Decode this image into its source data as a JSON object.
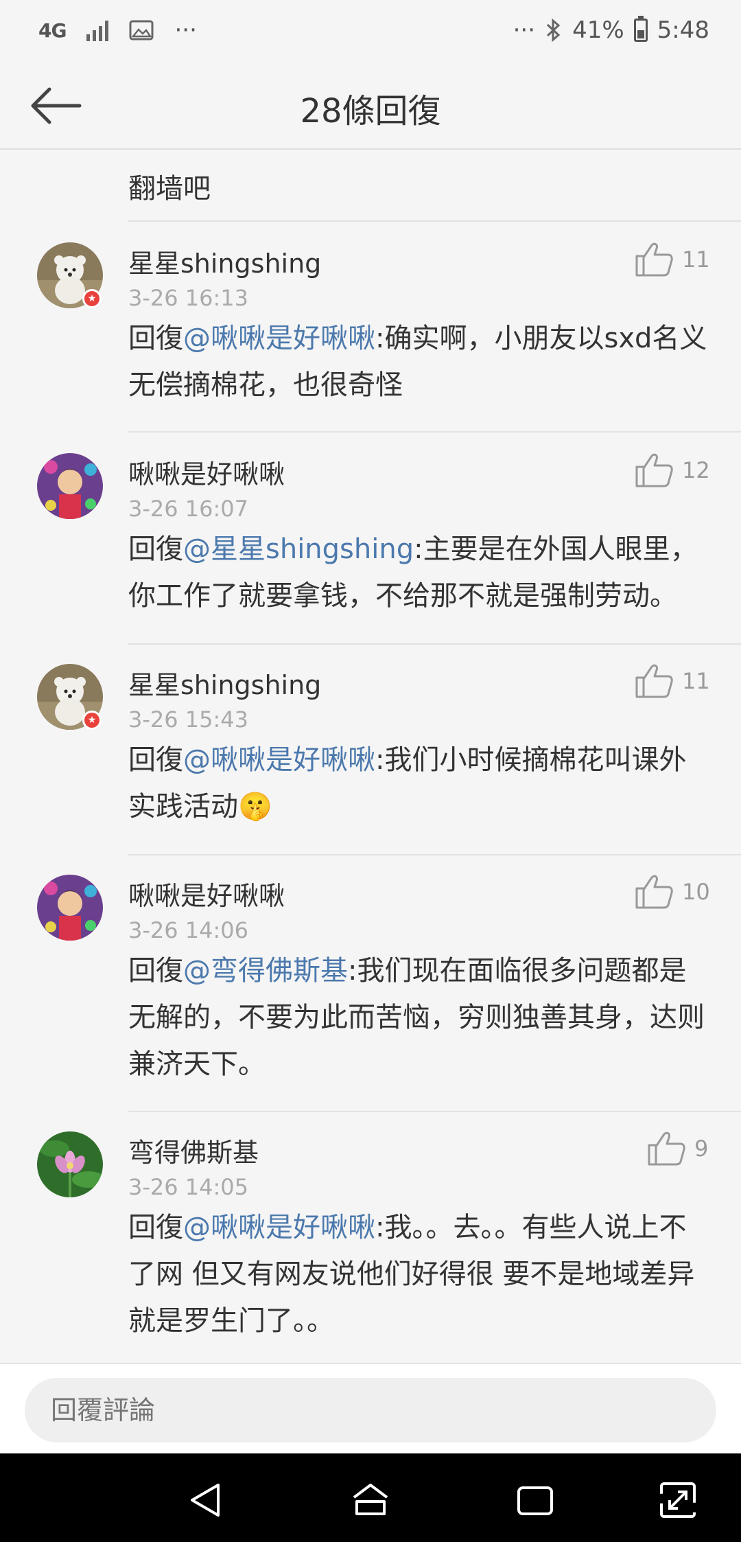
{
  "status_bar": {
    "network": "4G",
    "overflow_left": "···",
    "overflow_right": "···",
    "battery": "41%",
    "time": "5:48"
  },
  "header": {
    "title": "28條回復"
  },
  "parent_comment": {
    "text": "翻墙吧"
  },
  "comments": [
    {
      "name": "星星shingshing",
      "time": "3-26 16:13",
      "reply_prefix": "回復",
      "mention": "@啾啾是好啾啾",
      "text": ":确实啊，小朋友以sxd名义无偿摘棉花，也很奇怪",
      "likes": "11"
    },
    {
      "name": "啾啾是好啾啾",
      "time": "3-26 16:07",
      "reply_prefix": "回復",
      "mention": "@星星shingshing",
      "text": ":主要是在外国人眼里，你工作了就要拿钱，不给那不就是强制劳动。",
      "likes": "12"
    },
    {
      "name": "星星shingshing",
      "time": "3-26 15:43",
      "reply_prefix": "回復",
      "mention": "@啾啾是好啾啾",
      "text": ":我们小时候摘棉花叫课外实践活动🤫",
      "likes": "11"
    },
    {
      "name": "啾啾是好啾啾",
      "time": "3-26 14:06",
      "reply_prefix": "回復",
      "mention": "@弯得佛斯基",
      "text": ":我们现在面临很多问题都是无解的，不要为此而苦恼，穷则独善其身，达则兼济天下。",
      "likes": "10"
    },
    {
      "name": "弯得佛斯基",
      "time": "3-26 14:05",
      "reply_prefix": "回復",
      "mention": "@啾啾是好啾啾",
      "text": ":我。。去。。有些人说上不了网 但又有网友说他们好得很 要不是地域差异 就是罗生门了。。",
      "likes": "9"
    }
  ],
  "reply_bar": {
    "placeholder": "回覆評論"
  },
  "icons": {
    "back": "back-arrow-icon",
    "like": "thumbs-up-icon",
    "nav_back": "triangle-back-icon",
    "nav_home": "home-icon",
    "nav_recents": "recents-icon",
    "nav_expand": "expand-icon"
  },
  "colors": {
    "mention": "#4c79ad",
    "background": "#f5f5f5",
    "nav_bar": "#000000"
  }
}
